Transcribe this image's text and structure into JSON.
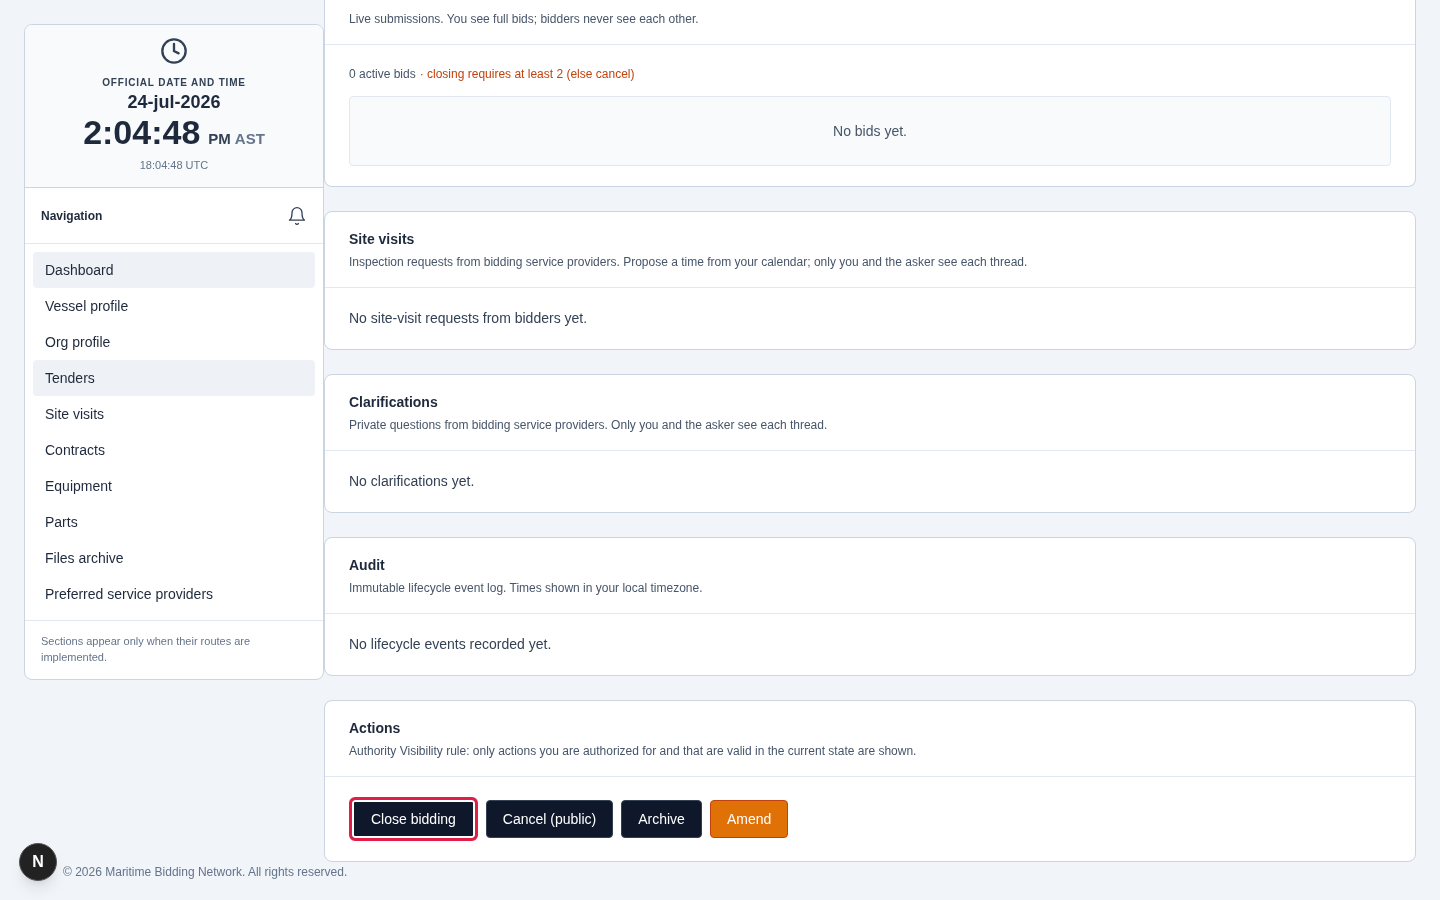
{
  "clock": {
    "label": "OFFICIAL DATE AND TIME",
    "date": "24-jul-2026",
    "time": "2:04:48",
    "meridiem": "PM",
    "zone": "AST",
    "utc": "18:04:48 UTC"
  },
  "navigation": {
    "title": "Navigation",
    "items": [
      {
        "label": "Dashboard",
        "selected": true
      },
      {
        "label": "Vessel profile",
        "selected": false
      },
      {
        "label": "Org profile",
        "selected": false
      },
      {
        "label": "Tenders",
        "selected": true
      },
      {
        "label": "Site visits",
        "selected": false
      },
      {
        "label": "Contracts",
        "selected": false
      },
      {
        "label": "Equipment",
        "selected": false
      },
      {
        "label": "Parts",
        "selected": false
      },
      {
        "label": "Files archive",
        "selected": false
      },
      {
        "label": "Preferred service providers",
        "selected": false
      }
    ],
    "note": "Sections appear only when their routes are implemented."
  },
  "bids": {
    "description": "Live submissions. You see full bids; bidders never see each other.",
    "count": "0 active bids",
    "warning": "· closing requires at least 2 (else cancel)",
    "empty": "No bids yet."
  },
  "sections": [
    {
      "title": "Site visits",
      "description": "Inspection requests from bidding service providers. Propose a time from your calendar; only you and the asker see each thread.",
      "empty": "No site-visit requests from bidders yet."
    },
    {
      "title": "Clarifications",
      "description": "Private questions from bidding service providers. Only you and the asker see each thread.",
      "empty": "No clarifications yet."
    },
    {
      "title": "Audit",
      "description": "Immutable lifecycle event log. Times shown in your local timezone.",
      "empty": "No lifecycle events recorded yet."
    }
  ],
  "actions": {
    "title": "Actions",
    "description": "Authority Visibility rule: only actions you are authorized for and that are valid in the current state are shown.",
    "buttons": [
      {
        "label": "Close bidding",
        "kind": "dark",
        "focused": true
      },
      {
        "label": "Cancel (public)",
        "kind": "dark",
        "focused": false
      },
      {
        "label": "Archive",
        "kind": "dark",
        "focused": false
      },
      {
        "label": "Amend",
        "kind": "accent",
        "focused": false
      }
    ]
  },
  "footer": "© 2026 Maritime Bidding Network. All rights reserved.",
  "dev_badge": "N"
}
